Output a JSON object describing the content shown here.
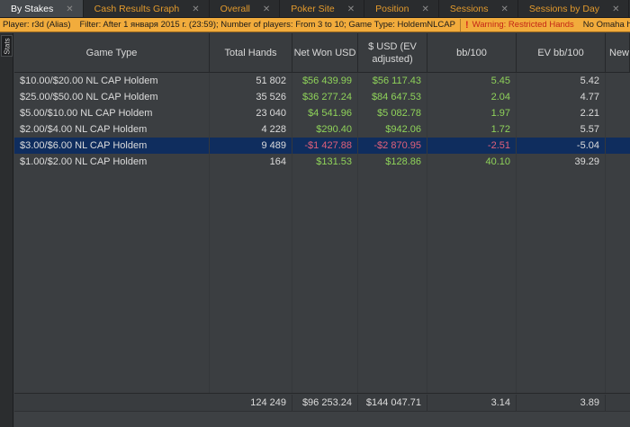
{
  "tabs": [
    {
      "label": "By Stakes",
      "active": true
    },
    {
      "label": "Cash Results Graph",
      "active": false
    },
    {
      "label": "Overall",
      "active": false
    },
    {
      "label": "Poker Site",
      "active": false
    },
    {
      "label": "Position",
      "active": false
    },
    {
      "label": "Sessions",
      "active": false
    },
    {
      "label": "Sessions by Day",
      "active": false
    }
  ],
  "filter": {
    "player": "Player: r3d (Alias)",
    "filter": "Filter: After 1 января 2015 г. (23:59); Number of players: From 3 to 10; Game Type: HoldemNLCAP",
    "warning": "Warning: Restricted Hands",
    "extra": "No Omaha hand"
  },
  "side": {
    "stats_label": "Stats"
  },
  "columns": [
    "Game Type",
    "Total Hands",
    "Net Won USD",
    "$ USD (EV adjusted)",
    "bb/100",
    "EV bb/100",
    "New"
  ],
  "rows": [
    {
      "game": "$10.00/$20.00 NL CAP Holdem",
      "hands": "51 802",
      "net": "$56 439.99",
      "ev": "$56 117.43",
      "bb": "5.45",
      "evbb": "5.42",
      "sign": "pos",
      "selected": false
    },
    {
      "game": "$25.00/$50.00 NL CAP Holdem",
      "hands": "35 526",
      "net": "$36 277.24",
      "ev": "$84 647.53",
      "bb": "2.04",
      "evbb": "4.77",
      "sign": "pos",
      "selected": false
    },
    {
      "game": "$5.00/$10.00 NL CAP Holdem",
      "hands": "23 040",
      "net": "$4 541.96",
      "ev": "$5 082.78",
      "bb": "1.97",
      "evbb": "2.21",
      "sign": "pos",
      "selected": false
    },
    {
      "game": "$2.00/$4.00 NL CAP Holdem",
      "hands": "4 228",
      "net": "$290.40",
      "ev": "$942.06",
      "bb": "1.72",
      "evbb": "5.57",
      "sign": "pos",
      "selected": false
    },
    {
      "game": "$3.00/$6.00 NL CAP Holdem",
      "hands": "9 489",
      "net": "-$1 427.88",
      "ev": "-$2 870.95",
      "bb": "-2.51",
      "evbb": "-5.04",
      "sign": "neg",
      "selected": true
    },
    {
      "game": "$1.00/$2.00 NL CAP Holdem",
      "hands": "164",
      "net": "$131.53",
      "ev": "$128.86",
      "bb": "40.10",
      "evbb": "39.29",
      "sign": "pos",
      "selected": false
    }
  ],
  "totals": {
    "hands": "124 249",
    "net": "$96 253.24",
    "ev": "$144 047.71",
    "bb": "3.14",
    "evbb": "3.89"
  },
  "colors": {
    "accent_tab": "#e39a2c",
    "filter_bg": "#f2ac3c",
    "positive": "#8fd35a",
    "negative": "#e0607a",
    "selected_row": "#0f2d5e"
  }
}
